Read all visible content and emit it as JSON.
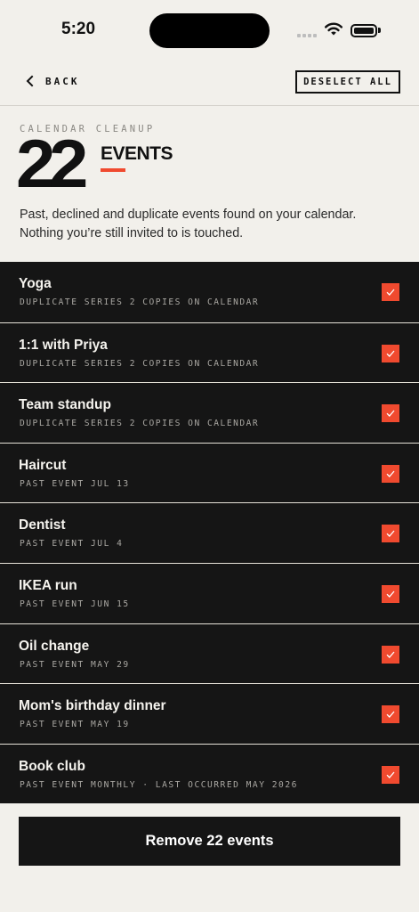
{
  "status_bar": {
    "time": "5:20"
  },
  "nav": {
    "back_label": "BACK",
    "deselect_label": "DESELECT ALL"
  },
  "header": {
    "eyebrow": "CALENDAR CLEANUP",
    "count": "22",
    "count_label": "EVENTS",
    "description": "Past, declined and duplicate events found on your calendar. Nothing you’re still invited to is touched."
  },
  "events": [
    {
      "title": "Yoga",
      "subtitle": "DUPLICATE SERIES 2 COPIES ON CALENDAR",
      "checked": true
    },
    {
      "title": "1:1 with Priya",
      "subtitle": "DUPLICATE SERIES 2 COPIES ON CALENDAR",
      "checked": true
    },
    {
      "title": "Team standup",
      "subtitle": "DUPLICATE SERIES 2 COPIES ON CALENDAR",
      "checked": true
    },
    {
      "title": "Haircut",
      "subtitle": "PAST EVENT JUL 13",
      "checked": true
    },
    {
      "title": "Dentist",
      "subtitle": "PAST EVENT JUL 4",
      "checked": true
    },
    {
      "title": "IKEA run",
      "subtitle": "PAST EVENT JUN 15",
      "checked": true
    },
    {
      "title": "Oil change",
      "subtitle": "PAST EVENT MAY 29",
      "checked": true
    },
    {
      "title": "Mom's birthday dinner",
      "subtitle": "PAST EVENT MAY 19",
      "checked": true
    },
    {
      "title": "Book club",
      "subtitle": "PAST EVENT MONTHLY · LAST OCCURRED MAY 2026",
      "checked": true
    }
  ],
  "footer": {
    "remove_label": "Remove 22 events"
  },
  "colors": {
    "accent": "#f04a2f",
    "background": "#f2f0eb",
    "row_bg": "#151515"
  },
  "icons": {
    "back": "chevron-left-icon",
    "check": "checkmark-icon",
    "wifi": "wifi-icon",
    "battery": "battery-icon"
  }
}
